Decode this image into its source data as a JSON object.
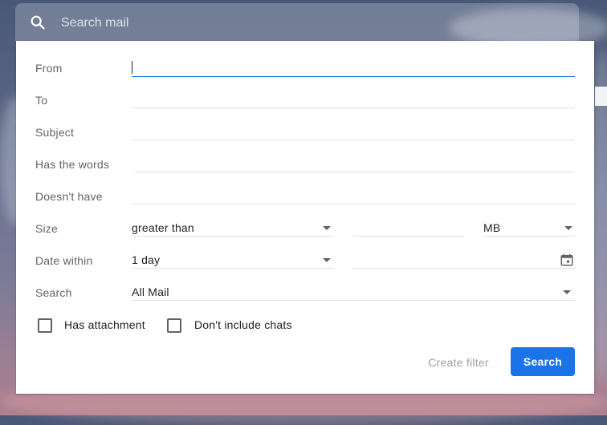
{
  "search": {
    "placeholder": "Search mail"
  },
  "form": {
    "from_label": "From",
    "to_label": "To",
    "subject_label": "Subject",
    "has_words_label": "Has the words",
    "doesnt_have_label": "Doesn't have",
    "size_label": "Size",
    "size_operator": "greater than",
    "size_unit": "MB",
    "date_within_label": "Date within",
    "date_within_value": "1 day",
    "search_scope_label": "Search",
    "search_scope_value": "All Mail",
    "has_attachment_label": "Has attachment",
    "dont_include_chats_label": "Don't include chats"
  },
  "actions": {
    "create_filter_label": "Create filter",
    "search_label": "Search"
  },
  "colors": {
    "accent": "#1a73e8",
    "label_gray": "#5f6368",
    "disabled_text": "#9aa0a6"
  },
  "icons": [
    "search-icon",
    "dropdown-arrow-icon",
    "calendar-icon",
    "checkbox-unchecked-icon"
  ]
}
